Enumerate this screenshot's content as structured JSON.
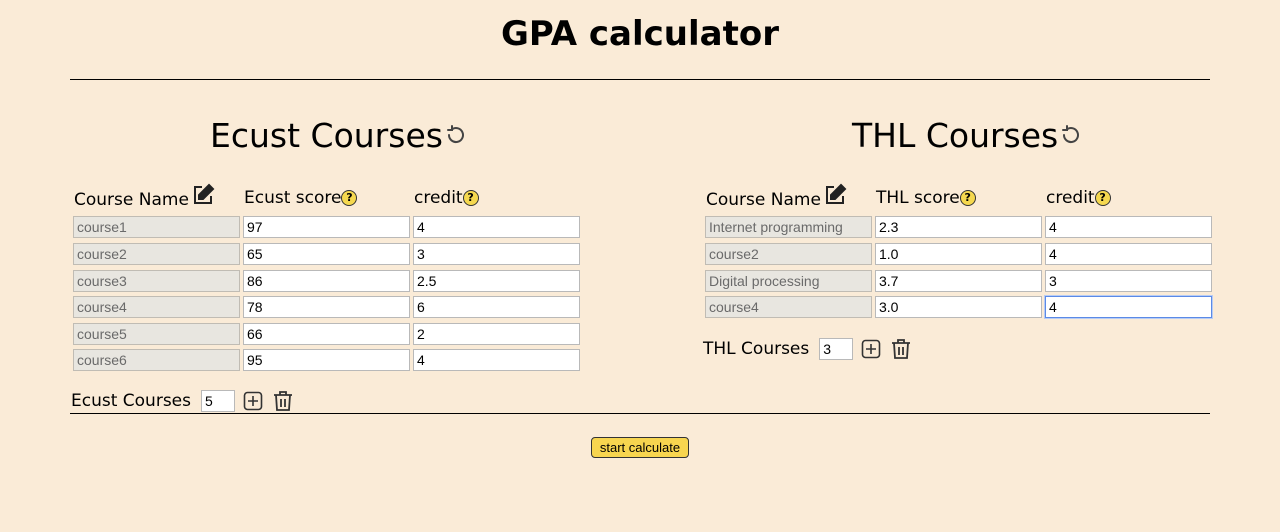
{
  "page": {
    "title": "GPA calculator"
  },
  "ecust": {
    "heading": "Ecust Courses",
    "col_name": "Course Name",
    "col_score": "Ecust score",
    "col_credit": "credit",
    "rows": [
      {
        "name": "course1",
        "score": "97",
        "credit": "4"
      },
      {
        "name": "course2",
        "score": "65",
        "credit": "3"
      },
      {
        "name": "course3",
        "score": "86",
        "credit": "2.5"
      },
      {
        "name": "course4",
        "score": "78",
        "credit": "6"
      },
      {
        "name": "course5",
        "score": "66",
        "credit": "2"
      },
      {
        "name": "course6",
        "score": "95",
        "credit": "4"
      }
    ],
    "count_label": "Ecust Courses",
    "count_value": "5"
  },
  "thl": {
    "heading": "THL Courses",
    "col_name": "Course Name",
    "col_score": "THL score",
    "col_credit": "credit",
    "rows": [
      {
        "name": "Internet programming",
        "score": "2.3",
        "credit": "4"
      },
      {
        "name": "course2",
        "score": "1.0",
        "credit": "4"
      },
      {
        "name": "Digital processing",
        "score": "3.7",
        "credit": "3"
      },
      {
        "name": "course4",
        "score": "3.0",
        "credit": "4"
      }
    ],
    "count_label": "THL Courses",
    "count_value": "3"
  },
  "actions": {
    "calculate_label": "start calculate"
  },
  "icons": {
    "reset": "reset-icon",
    "edit": "edit-icon",
    "help": "help-icon",
    "add": "add-icon",
    "trash": "trash-icon"
  },
  "colors": {
    "background": "#faebd7",
    "button": "#f7d54f",
    "help": "#f5d84f"
  }
}
